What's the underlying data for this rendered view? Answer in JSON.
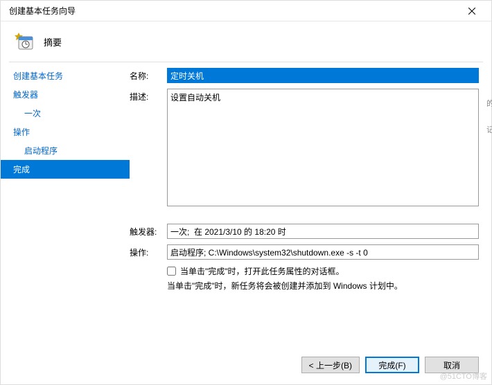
{
  "window": {
    "title": "创建基本任务向导"
  },
  "header": {
    "title": "摘要"
  },
  "sidebar": {
    "items": [
      {
        "label": "创建基本任务",
        "indent": 0,
        "selected": false
      },
      {
        "label": "触发器",
        "indent": 0,
        "selected": false
      },
      {
        "label": "一次",
        "indent": 1,
        "selected": false
      },
      {
        "label": "操作",
        "indent": 0,
        "selected": false
      },
      {
        "label": "启动程序",
        "indent": 1,
        "selected": false
      },
      {
        "label": "完成",
        "indent": 0,
        "selected": true
      }
    ]
  },
  "form": {
    "name_label": "名称:",
    "name_value": "定时关机",
    "desc_label": "描述:",
    "desc_value": "设置自动关机",
    "trigger_label": "触发器:",
    "trigger_value": "一次;  在 2021/3/10 的 18:20 时",
    "action_label": "操作:",
    "action_value": "启动程序; C:\\Windows\\system32\\shutdown.exe -s -t 0",
    "checkbox_label": "当单击\"完成\"时，打开此任务属性的对话框。",
    "info_text": "当单击\"完成\"时，新任务将会被创建并添加到 Windows 计划中。"
  },
  "buttons": {
    "back": "< 上一步(B)",
    "finish": "完成(F)",
    "cancel": "取消"
  },
  "watermark": "@51CTO博客",
  "edge_hint_1": "的",
  "edge_hint_2": "记"
}
